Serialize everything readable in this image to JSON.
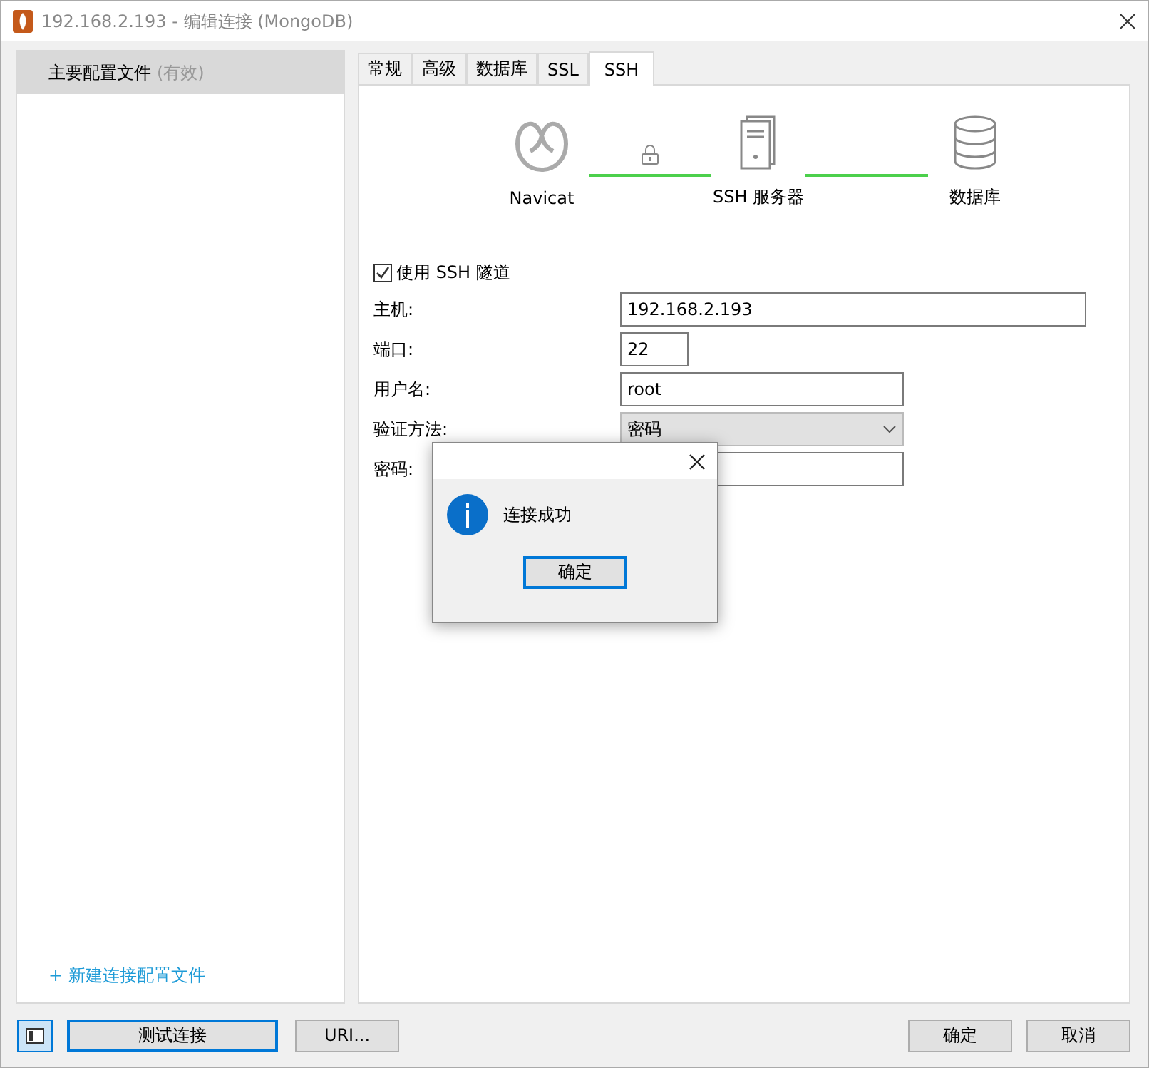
{
  "window": {
    "title": "192.168.2.193 - 编辑连接 (MongoDB)"
  },
  "sidebar": {
    "items": [
      {
        "label": "主要配置文件",
        "note": "(有效)",
        "selected": true
      }
    ],
    "add_link": "+ 新建连接配置文件"
  },
  "tabs": [
    {
      "label": "常规",
      "selected": false
    },
    {
      "label": "高级",
      "selected": false
    },
    {
      "label": "数据库",
      "selected": false
    },
    {
      "label": "SSL",
      "selected": false
    },
    {
      "label": "SSH",
      "selected": true
    }
  ],
  "diagram": {
    "nodes": [
      {
        "kind": "navicat",
        "label": "Navicat"
      },
      {
        "kind": "server",
        "label": "SSH 服务器"
      },
      {
        "kind": "database",
        "label": "数据库"
      }
    ]
  },
  "ssh": {
    "use_tunnel": {
      "label": "使用 SSH 隧道",
      "checked": true
    },
    "fields": [
      {
        "kind": "input",
        "label": "主机:",
        "value": "192.168.2.193"
      },
      {
        "kind": "input",
        "label": "端口:",
        "value": "22"
      },
      {
        "kind": "input",
        "label": "用户名:",
        "value": "root"
      },
      {
        "kind": "select",
        "label": "验证方法:",
        "value": "密码"
      },
      {
        "kind": "password",
        "label": "密码:"
      }
    ]
  },
  "dialog": {
    "message": "连接成功",
    "button": "确定"
  },
  "footer": {
    "left_buttons": [
      {
        "label": "测试连接",
        "focused": true
      },
      {
        "label": "URI...",
        "focused": false
      }
    ],
    "right_buttons": [
      "确定",
      "取消"
    ]
  }
}
